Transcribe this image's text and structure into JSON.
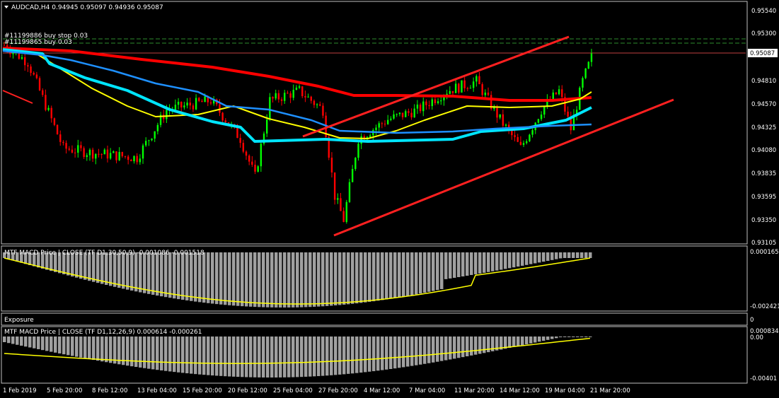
{
  "header": {
    "symbol_line": "AUDCAD,H4  0.94945 0.95097 0.94936 0.95087",
    "order_lines": [
      "#11199886 buy stop 0.03",
      "#11199865 buy 0.03"
    ]
  },
  "price_panel": {
    "price_badge": "0.95087",
    "yticks": [
      "0.95540",
      "0.95300",
      "0.95087",
      "0.94810",
      "0.94570",
      "0.94325",
      "0.94080",
      "0.93835",
      "0.93595",
      "0.93350",
      "0.93105"
    ]
  },
  "panel2": {
    "label": "MTF MACD Price | CLOSE  (TF D1,30,50,9) -0.001086 -0.001518",
    "ticks": [
      "0.000165",
      "-0.002421"
    ]
  },
  "panel3": {
    "label": "Exposure",
    "ticks": [
      "0"
    ]
  },
  "panel4": {
    "label": "MTF MACD Price | CLOSE  (TF D1,12,26,9) 0.000614 -0.000261",
    "ticks": [
      "0.000834",
      "0.00",
      "-0.00401"
    ]
  },
  "xaxis": {
    "labels": [
      "1 Feb 2019",
      "5 Feb 20:00",
      "8 Feb 12:00",
      "13 Feb 04:00",
      "15 Feb 20:00",
      "20 Feb 12:00",
      "25 Feb 04:00",
      "27 Feb 20:00",
      "4 Mar 12:00",
      "7 Mar 04:00",
      "11 Mar 20:00",
      "14 Mar 12:00",
      "19 Mar 04:00",
      "21 Mar 20:00"
    ]
  },
  "colors": {
    "bull": "#00ff00",
    "bear": "#ff0000",
    "ma_slow": "#ff0000",
    "ma_fast": "#ffff00",
    "ma_cyan": "#00e5ff",
    "ma_blue": "#1e90ff",
    "trendline": "#ff2020",
    "histogram": "#a0a0a0",
    "signal": "#ffff00",
    "grid_frame": "#c0c0c0"
  },
  "chart_data": [
    {
      "type": "candlestick",
      "title": "AUDCAD,H4",
      "ylim": [
        0.93105,
        0.9554
      ],
      "x_start": "1 Feb 2019",
      "last_close": 0.95087,
      "indicators": [
        "moving averages",
        "trend channel"
      ]
    },
    {
      "type": "bar",
      "title": "MTF MACD Price | CLOSE  (TF D1,30,50,9)",
      "values_last": [
        -0.001086,
        -0.001518
      ],
      "ylim": [
        -0.002421,
        0.000165
      ]
    },
    {
      "type": "bar",
      "title": "MTF MACD Price | CLOSE  (TF D1,12,26,9)",
      "values_last": [
        0.000614,
        -0.000261
      ],
      "ylim": [
        -0.00401,
        0.000834
      ]
    }
  ]
}
